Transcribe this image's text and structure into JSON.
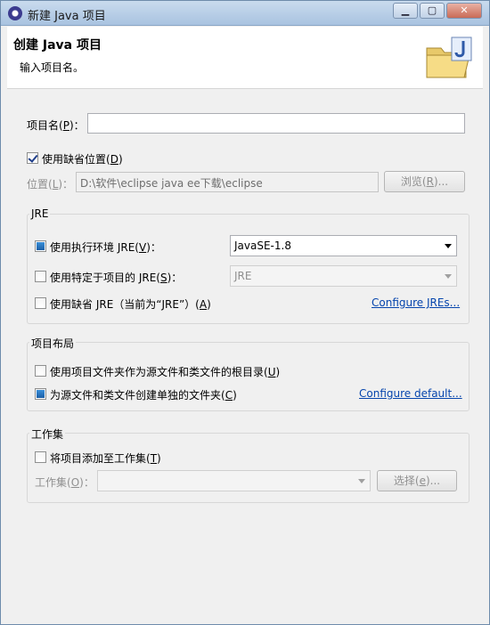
{
  "window": {
    "title": "新建 Java 项目",
    "buttons": {
      "minimize": "▁",
      "maximize": "▢",
      "close": "✕"
    }
  },
  "header": {
    "title": "创建 Java 项目",
    "subtitle": "输入项目名。"
  },
  "project_name": {
    "label": "项目名(",
    "mnemonic": "P",
    "label_end": ")：",
    "value": ""
  },
  "use_default_location": {
    "label": "使用缺省位置(",
    "mnemonic": "D",
    "label_end": ")",
    "checked": true
  },
  "location": {
    "label": "位置(",
    "mnemonic": "L",
    "label_end": ")：",
    "value": "D:\\软件\\eclipse java ee下载\\eclipse",
    "browse_label": "浏览(",
    "browse_mnemonic": "R",
    "browse_end": ")..."
  },
  "jre_group": {
    "title": "JRE",
    "option1": {
      "label": "使用执行环境 JRE(",
      "mnemonic": "V",
      "label_end": ")：",
      "selected": true,
      "combo_value": "JavaSE-1.8"
    },
    "option2": {
      "label": "使用特定于项目的 JRE(",
      "mnemonic": "S",
      "label_end": ")：",
      "selected": false,
      "combo_value": "JRE"
    },
    "option3": {
      "label": "使用缺省 JRE（当前为“JRE”）(",
      "mnemonic": "A",
      "label_end": ")",
      "selected": false
    },
    "configure_link": "Configure JREs..."
  },
  "layout_group": {
    "title": "项目布局",
    "option1": {
      "label": "使用项目文件夹作为源文件和类文件的根目录(",
      "mnemonic": "U",
      "label_end": ")",
      "selected": false
    },
    "option2": {
      "label": "为源文件和类文件创建单独的文件夹(",
      "mnemonic": "C",
      "label_end": ")",
      "selected": true
    },
    "configure_link": "Configure default..."
  },
  "working_set_group": {
    "title": "工作集",
    "add_label": "将项目添加至工作集(",
    "add_mnemonic": "T",
    "add_end": ")",
    "add_checked": false,
    "set_label": "工作集(",
    "set_mnemonic": "O",
    "set_end": ")：",
    "set_value": "",
    "select_label": "选择(",
    "select_mnemonic": "e",
    "select_end": ")..."
  }
}
